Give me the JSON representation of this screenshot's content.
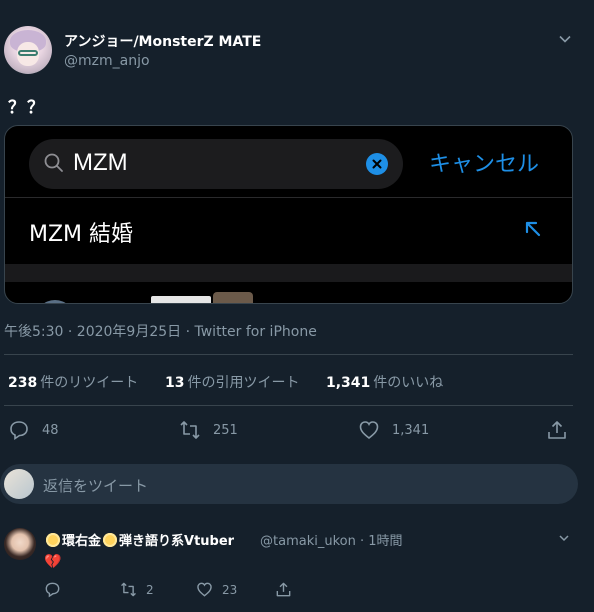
{
  "tweet": {
    "author": {
      "display_name": "アンジョー/MonsterZ MATE",
      "handle": "@mzm_anjo"
    },
    "text": "？？",
    "media": {
      "search_value": "MZM",
      "cancel_label": "キャンセル",
      "suggestion": "MZM 結婚"
    },
    "meta": "午後5:30 · 2020年9月25日 · Twitter for iPhone",
    "stats": {
      "retweets": {
        "count": "238",
        "label": "件のリツイート"
      },
      "quotes": {
        "count": "13",
        "label": "件の引用ツイート"
      },
      "likes": {
        "count": "1,341",
        "label": "件のいいね"
      }
    },
    "actions": {
      "reply_count": "48",
      "retweet_count": "251",
      "like_count": "1,341"
    }
  },
  "reply_composer": {
    "placeholder": "返信をツイート"
  },
  "reply_tweet": {
    "name_part1": "環右金",
    "name_part2": "弾き語り系Vtuber",
    "handle_time": "@tamaki_ukon · 1時間",
    "body": "💔",
    "actions": {
      "retweet_count": "2",
      "like_count": "23"
    }
  },
  "icons": [
    "chevron-down-icon",
    "search-icon",
    "clear-icon",
    "arrow-up-left-icon",
    "reply-icon",
    "retweet-icon",
    "like-icon",
    "share-icon",
    "sun-emoji-icon"
  ],
  "colors": {
    "background": "#15202b",
    "accent": "#1e8fe6",
    "muted": "#8899a6",
    "border": "#38444d"
  }
}
